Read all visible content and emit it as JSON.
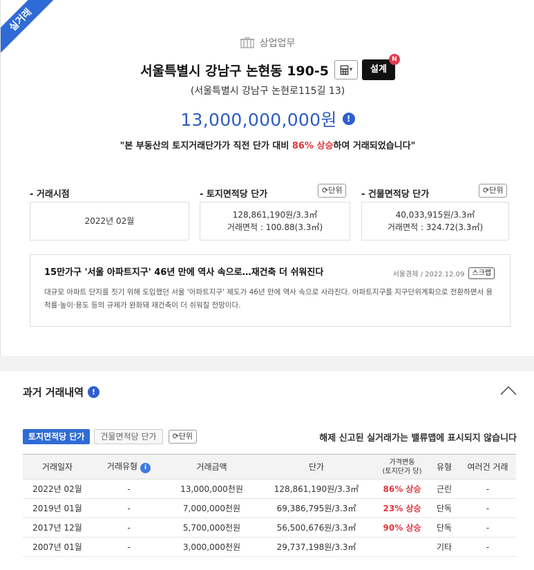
{
  "ribbon": "실거래",
  "property": {
    "category": "상업업무",
    "address": "서울특별시 강남구 논현동 190-5",
    "design_label": "설계",
    "new_badge": "N",
    "road_address": "(서울특별시 강남구 논현로115길 13)",
    "price": "13,000,000,000원",
    "rise_prefix": "\"본 부동산의 토지거래단가가 직전 단가 대비 ",
    "rise_percent": "86% 상승",
    "rise_suffix": "하여 거래되었습니다\""
  },
  "metrics": {
    "unit_label": "단위",
    "trade_date": {
      "label": "- 거래시점",
      "value": "2022년 02월"
    },
    "land": {
      "label": "- 토지면적당 단가",
      "value": "128,861,190원/3.3㎡",
      "area": "거래면적 : 100.88(3.3㎡)"
    },
    "building": {
      "label": "- 건물면적당 단가",
      "value": "40,033,915원/3.3㎡",
      "area": "거래면적 : 324.72(3.3㎡)"
    }
  },
  "news": {
    "title": "15만가구 '서울 아파트지구' 46년 만에 역사 속으로…재건축 더 쉬워진다",
    "source": "서울경제  /  2022.12.09",
    "scrap_label": "스크랩",
    "body": "대규모 아파트 단지를 짓기 위해 도입했던 서울 '아파트지구' 제도가 46년 만에 역사 속으로 사라진다. 아파트지구를 지구단위계획으로 전환하면서 용적률·높이·용도 등의 규제가 완화돼 재건축이 더 쉬워질 전망이다."
  },
  "history": {
    "title": "과거 거래내역",
    "tab_land": "토지면적당 단가",
    "tab_building": "건물면적당 단가",
    "unit_label": "단위",
    "notice": "해제 신고된 실거래가는 밸류맵에 표시되지 않습니다",
    "columns": {
      "date": "거래일자",
      "type": "거래유형",
      "amount": "거래금액",
      "unit_price": "단가",
      "change_1": "가격변동",
      "change_2": "(토지단가 당)",
      "kind": "유형",
      "multi": "여러건 거래"
    },
    "rows": [
      {
        "date": "2022년 02월",
        "type": "-",
        "amount": "13,000,000천원",
        "unit_price": "128,861,190원/3.3㎡",
        "change": "86% 상승",
        "kind": "근린",
        "multi": "-"
      },
      {
        "date": "2019년 01월",
        "type": "-",
        "amount": "7,000,000천원",
        "unit_price": "69,386,795원/3.3㎡",
        "change": "23% 상승",
        "kind": "단독",
        "multi": "-"
      },
      {
        "date": "2017년 12월",
        "type": "-",
        "amount": "5,700,000천원",
        "unit_price": "56,500,676원/3.3㎡",
        "change": "90% 상승",
        "kind": "단독",
        "multi": "-"
      },
      {
        "date": "2007년 01월",
        "type": "-",
        "amount": "3,000,000천원",
        "unit_price": "29,737,198원/3.3㎡",
        "change": "",
        "kind": "기타",
        "multi": "-"
      }
    ]
  }
}
